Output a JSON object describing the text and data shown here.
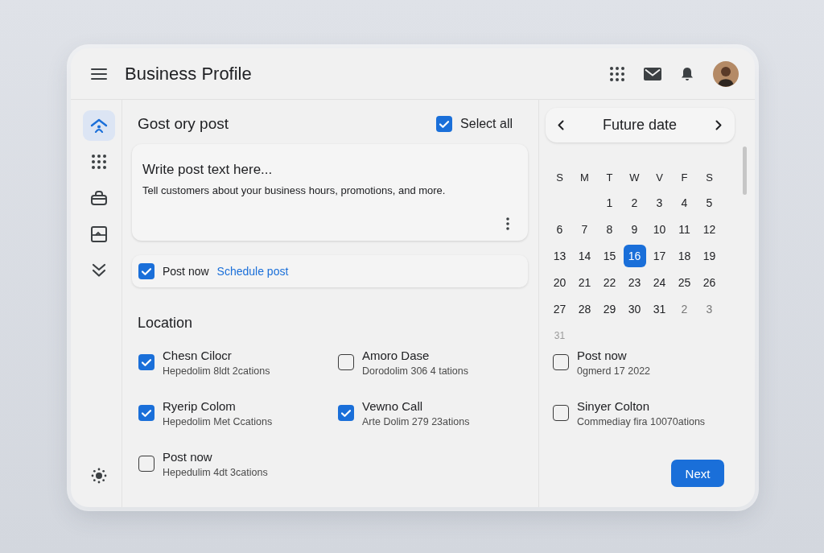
{
  "header": {
    "title": "Business Profile"
  },
  "rail": {
    "items": [
      {
        "selected": true
      },
      {
        "selected": false
      },
      {
        "selected": false
      },
      {
        "selected": false
      },
      {
        "selected": false
      }
    ]
  },
  "composer": {
    "title": "Gost ory post",
    "select_all": {
      "label": "Select all",
      "checked": true
    },
    "post_field": {
      "placeholder": "Write post text here...",
      "hint": "Tell customers about your business hours, promotions, and more."
    },
    "schedule": {
      "label": "Post now",
      "checked": true,
      "link": "Schedule post"
    }
  },
  "location": {
    "title": "Location",
    "items": [
      {
        "name": "Chesn Cilocr",
        "detail": "Hepedolim 8ldt 2cations",
        "checked": true
      },
      {
        "name": "Amoro Dase",
        "detail": "Dorodolim 306 4 tations",
        "checked": false
      },
      {
        "name": "Ryerip Colom",
        "detail": "Hepedolim Met Ccations",
        "checked": true
      },
      {
        "name": "Vewno Call",
        "detail": "Arte Dolim 279 23ations",
        "checked": true
      },
      {
        "name": "Post now",
        "detail": "Hepedulim 4dt 3cations",
        "checked": false
      }
    ]
  },
  "calendar": {
    "title": "Future date",
    "weekdays": [
      "S",
      "M",
      "T",
      "W",
      "V",
      "F",
      "S"
    ],
    "weeks": [
      [
        {
          "day": "1",
          "kind": "current",
          "selected": false
        },
        {
          "day": "2",
          "kind": "current",
          "selected": false
        },
        {
          "day": "3",
          "kind": "current",
          "selected": false
        },
        {
          "day": "4",
          "kind": "current",
          "selected": false
        },
        {
          "day": "5",
          "kind": "current",
          "selected": false
        }
      ],
      [
        {
          "day": "6",
          "kind": "current",
          "selected": false
        },
        {
          "day": "7",
          "kind": "current",
          "selected": false
        },
        {
          "day": "8",
          "kind": "current",
          "selected": false
        },
        {
          "day": "9",
          "kind": "current",
          "selected": false
        },
        {
          "day": "10",
          "kind": "current",
          "selected": false
        },
        {
          "day": "11",
          "kind": "current",
          "selected": false
        },
        {
          "day": "12",
          "kind": "current",
          "selected": false
        }
      ],
      [
        {
          "day": "13",
          "kind": "current",
          "selected": false
        },
        {
          "day": "14",
          "kind": "current",
          "selected": false
        },
        {
          "day": "15",
          "kind": "current",
          "selected": false
        },
        {
          "day": "16",
          "kind": "current",
          "selected": true
        },
        {
          "day": "17",
          "kind": "current",
          "selected": false
        },
        {
          "day": "18",
          "kind": "current",
          "selected": false
        },
        {
          "day": "19",
          "kind": "current",
          "selected": false
        }
      ],
      [
        {
          "day": "20",
          "kind": "current",
          "selected": false
        },
        {
          "day": "21",
          "kind": "current",
          "selected": false
        },
        {
          "day": "22",
          "kind": "current",
          "selected": false
        },
        {
          "day": "23",
          "kind": "current",
          "selected": false
        },
        {
          "day": "24",
          "kind": "current",
          "selected": false
        },
        {
          "day": "25",
          "kind": "current",
          "selected": false
        },
        {
          "day": "26",
          "kind": "current",
          "selected": false
        }
      ],
      [
        {
          "day": "27",
          "kind": "current",
          "selected": false
        },
        {
          "day": "28",
          "kind": "current",
          "selected": false
        },
        {
          "day": "29",
          "kind": "current",
          "selected": false
        },
        {
          "day": "30",
          "kind": "current",
          "selected": false
        },
        {
          "day": "31",
          "kind": "current",
          "selected": false
        },
        {
          "day": "2",
          "kind": "adjacent",
          "selected": false
        },
        {
          "day": "3",
          "kind": "adjacent",
          "selected": false
        }
      ],
      [
        {
          "day": "31",
          "kind": "faded",
          "selected": false
        }
      ]
    ]
  },
  "options": [
    {
      "label": "Post now",
      "detail": "0gmerd 17 2022",
      "checked": false
    },
    {
      "label": "Sinyer Colton",
      "detail": "Commediay fira 10070ations",
      "checked": false
    }
  ],
  "next_button": "Next"
}
